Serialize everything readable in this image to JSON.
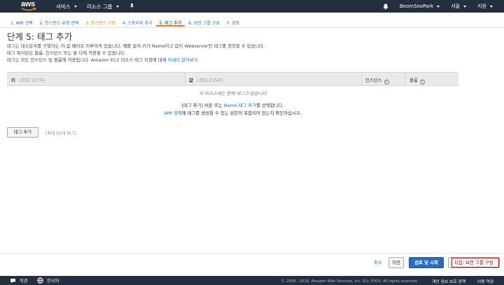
{
  "nav": {
    "logo": "aws",
    "services": "서비스",
    "resource_groups": "리소스 그룹",
    "user": "BeomSooPark",
    "region": "서울",
    "support": "지원"
  },
  "steps": [
    {
      "label": "1. AMI 선택",
      "state": "link"
    },
    {
      "label": "2. 인스턴스 유형 선택",
      "state": "link"
    },
    {
      "label": "3. 인스턴스 구성",
      "state": "orange"
    },
    {
      "label": "4. 스토리지 추가",
      "state": "link"
    },
    {
      "label": "5. 태그 추가",
      "state": "active"
    },
    {
      "label": "6. 보안 그룹 구성",
      "state": "link"
    },
    {
      "label": "7. 검토",
      "state": "link"
    }
  ],
  "page": {
    "title": "단계 5: 태그 추가",
    "desc1": "태그는 대소문자를 구별하는 키-값 페어로 이루어져 있습니다. 예를 들어 키가 Name이고 값이 Webserver인 태그를 정의할 수 있습니다.",
    "desc2": "태그 복사본은 볼륨, 인스턴스 또는 둘 다에 적용될 수 있습니다.",
    "desc3": "태그는 모든 인스턴스 및 볼륨에 적용됩니다. Amazon EC2 리소스 태그 지정에 대해",
    "desc3_link": "자세히 알아보기"
  },
  "table": {
    "col_key": "키",
    "col_key_hint": "(최대 127자)",
    "col_value": "값",
    "col_value_hint": "(최대 255자)",
    "col_instance": "인스턴스",
    "col_volume": "볼륨",
    "empty_msg": "이 리소스에는 현재 태그가 없습니다",
    "hint_prefix": "[태그 추가] 버튼 또는",
    "hint_link": "Name 태그 추가",
    "hint_suffix": "를 선택합니다.",
    "iam_link": "IAM 정책",
    "iam_suffix": "에 태그를 생성할 수 있는 권한이 포함되어 있는지 확인하십시오."
  },
  "add_tag": {
    "label": "태그 추가",
    "limit": "(최대 50개 태그)"
  },
  "actions": {
    "cancel": "취소",
    "previous": "이전",
    "review_launch": "검토 및 시작",
    "next": "다음: 보안 그룹 구성"
  },
  "footer": {
    "feedback": "의견",
    "language": "한국어",
    "copyright": "© 2008 - 2018, Amazon Web Services, Inc. 또는 자회사. All rights reserved.",
    "privacy": "개인 정보 보호 정책",
    "terms": "이용 약관"
  },
  "colors": {
    "nav_bg": "#232f3e",
    "link": "#1f6fb5",
    "accent_orange": "#e07b18",
    "primary_button": "#2a6ebb",
    "highlight_box": "#d6000f"
  }
}
